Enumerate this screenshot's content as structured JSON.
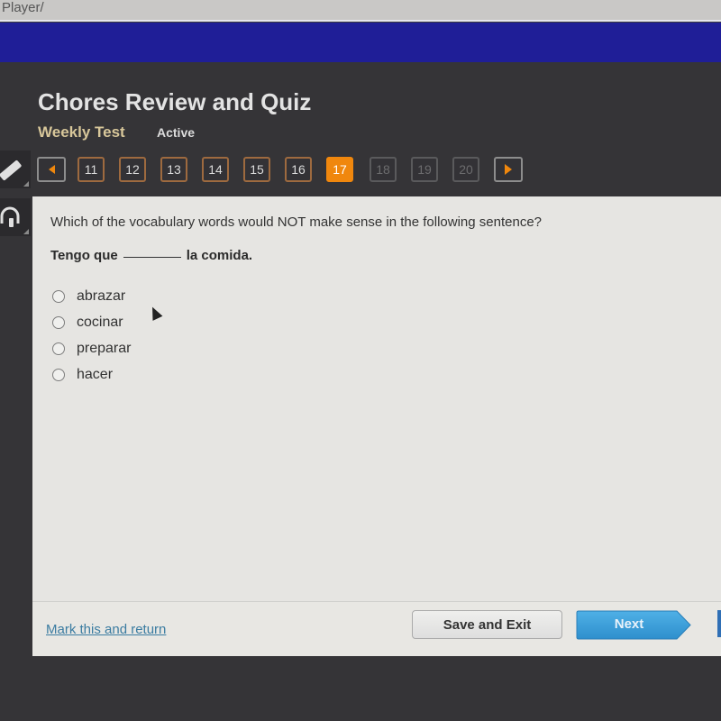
{
  "browser": {
    "url_fragment": "Player/"
  },
  "header": {
    "title": "Chores Review and Quiz",
    "subtitle": "Weekly Test",
    "status": "Active"
  },
  "tools": [
    {
      "name": "pencil-icon"
    },
    {
      "name": "headphones-icon"
    }
  ],
  "pagination": {
    "prev_icon": "triangle-left",
    "next_icon": "triangle-right",
    "pages": [
      {
        "label": "11",
        "state": "visited"
      },
      {
        "label": "12",
        "state": "visited"
      },
      {
        "label": "13",
        "state": "visited"
      },
      {
        "label": "14",
        "state": "visited"
      },
      {
        "label": "15",
        "state": "visited"
      },
      {
        "label": "16",
        "state": "visited"
      },
      {
        "label": "17",
        "state": "active"
      },
      {
        "label": "18",
        "state": "disabled"
      },
      {
        "label": "19",
        "state": "disabled"
      },
      {
        "label": "20",
        "state": "disabled"
      }
    ]
  },
  "question": {
    "prompt": "Which of the vocabulary words would NOT make sense in the following sentence?",
    "sentence_before": "Tengo que",
    "sentence_after": "la comida.",
    "options": [
      "abrazar",
      "cocinar",
      "preparar",
      "hacer"
    ],
    "selected": null
  },
  "footer": {
    "mark_link": "Mark this and return",
    "save_exit": "Save and Exit",
    "next": "Next"
  },
  "colors": {
    "accent_orange": "#f0870d",
    "top_bar_blue": "#1f1e97",
    "next_blue": "#3a9fd8",
    "link_blue": "#3b7ca1"
  }
}
